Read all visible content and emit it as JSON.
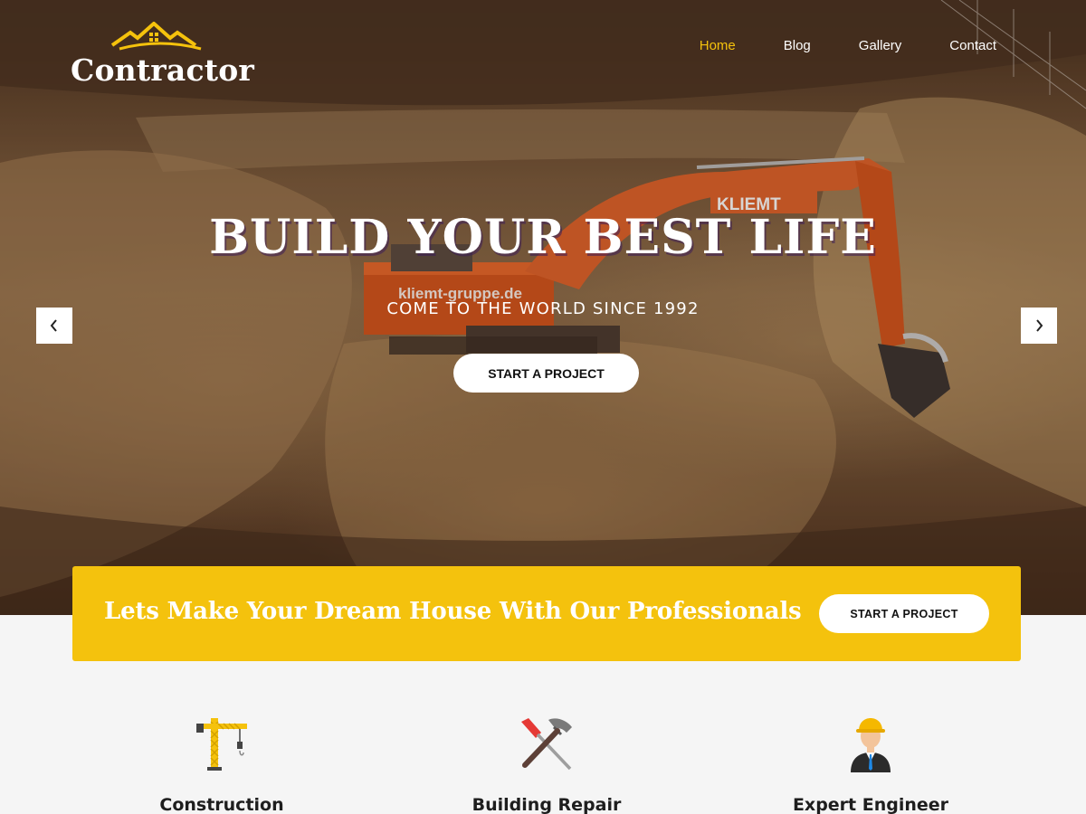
{
  "brand": {
    "name": "Contractor",
    "accent": "#f5c20c"
  },
  "nav": {
    "items": [
      {
        "label": "Home",
        "active": true
      },
      {
        "label": "Blog",
        "active": false
      },
      {
        "label": "Gallery",
        "active": false
      },
      {
        "label": "Contact",
        "active": false
      }
    ]
  },
  "hero": {
    "title": "BUILD YOUR BEST LIFE",
    "subtitle": "COME TO THE WORLD SINCE 1992",
    "button_label": "START A PROJECT",
    "prev_icon": "chevron-left-icon",
    "next_icon": "chevron-right-icon",
    "excavator_brand": "KLIEMT",
    "excavator_text": "kliemt-gruppe.de"
  },
  "cta": {
    "text": "Lets Make Your Dream House With Our Professionals",
    "button_label": "START A PROJECT",
    "background": "#f4c20d"
  },
  "services": [
    {
      "title": "Construction",
      "icon": "crane-icon"
    },
    {
      "title": "Building Repair",
      "icon": "hammer-screwdriver-icon"
    },
    {
      "title": "Expert Engineer",
      "icon": "engineer-icon"
    }
  ]
}
